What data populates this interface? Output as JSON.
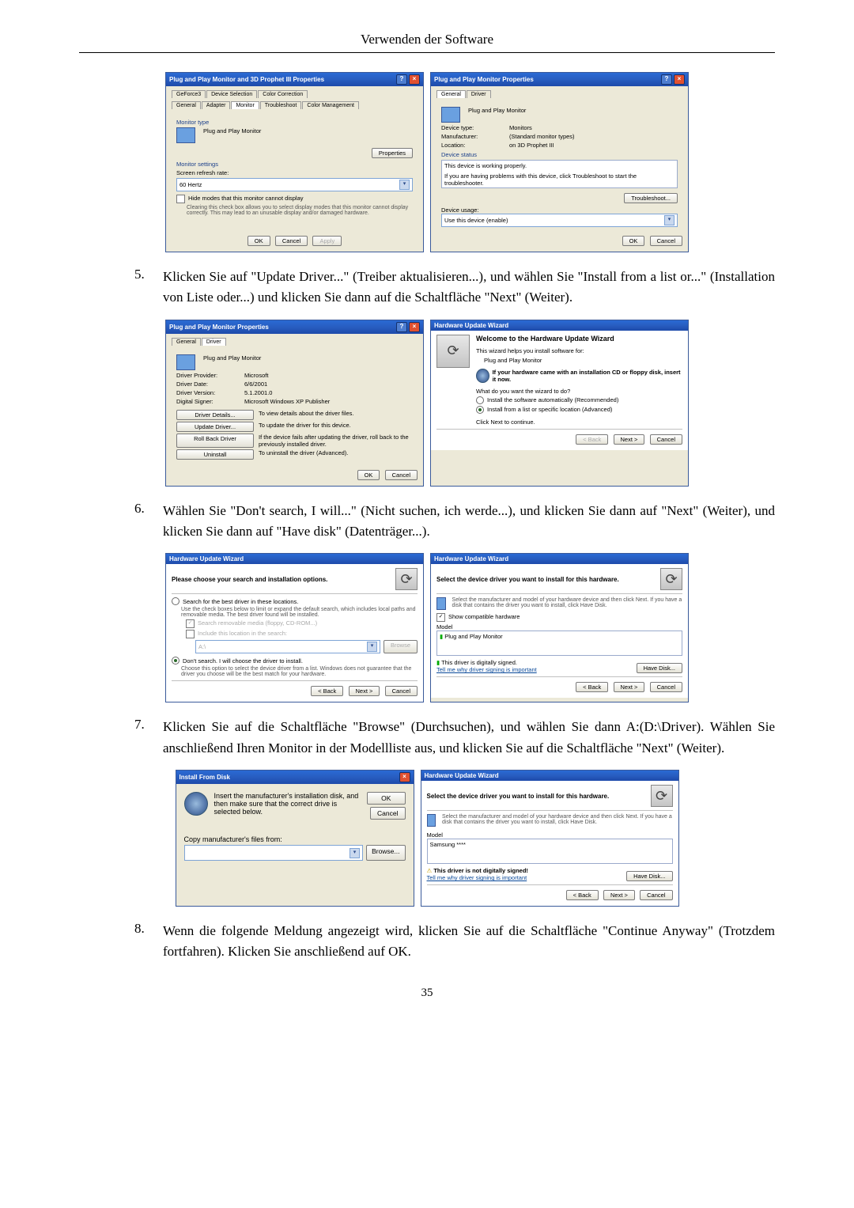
{
  "header": "Verwenden der Software",
  "page_number": "35",
  "steps": {
    "5": {
      "num": "5.",
      "text": "Klicken Sie auf \"Update Driver...\" (Treiber aktualisieren...), und wählen Sie \"Install from a list or...\" (Installation von Liste oder...) und klicken Sie dann auf die Schaltfläche \"Next\" (Weiter)."
    },
    "6": {
      "num": "6.",
      "text": "Wählen Sie \"Don't search, I will...\" (Nicht suchen, ich werde...), und klicken Sie dann auf \"Next\" (Weiter), und klicken Sie dann auf \"Have disk\" (Datenträger...)."
    },
    "7": {
      "num": "7.",
      "text": "Klicken Sie auf die Schaltfläche \"Browse\" (Durchsuchen), und wählen Sie dann A:(D:\\Driver). Wählen Sie anschließend Ihren Monitor in der Modellliste aus, und klicken Sie auf die Schaltfläche \"Next\" (Weiter)."
    },
    "8": {
      "num": "8.",
      "text": "Wenn die folgende Meldung angezeigt wird, klicken Sie auf die Schaltfläche \"Continue Anyway\" (Trotzdem fortfahren). Klicken Sie anschließend auf OK."
    }
  },
  "fig_a1": {
    "title": "Plug and Play Monitor and 3D Prophet III Properties",
    "tabs_row1": [
      "GeForce3",
      "Device Selection",
      "Color Correction"
    ],
    "tabs_row2": [
      "General",
      "Adapter",
      "Monitor",
      "Troubleshoot",
      "Color Management"
    ],
    "monitor_type": "Monitor type",
    "monitor_name": "Plug and Play Monitor",
    "properties_btn": "Properties",
    "monitor_settings": "Monitor settings",
    "refresh_label": "Screen refresh rate:",
    "refresh_value": "60 Hertz",
    "hide_modes": "Hide modes that this monitor cannot display",
    "hide_desc": "Clearing this check box allows you to select display modes that this monitor cannot display correctly. This may lead to an unusable display and/or damaged hardware.",
    "ok": "OK",
    "cancel": "Cancel",
    "apply": "Apply"
  },
  "fig_a2": {
    "title": "Plug and Play Monitor Properties",
    "tabs": [
      "General",
      "Driver"
    ],
    "name": "Plug and Play Monitor",
    "rows": {
      "type_l": "Device type:",
      "type_v": "Monitors",
      "manu_l": "Manufacturer:",
      "manu_v": "(Standard monitor types)",
      "loc_l": "Location:",
      "loc_v": "on 3D Prophet III"
    },
    "status_lbl": "Device status",
    "status_txt": "This device is working properly.",
    "status_help": "If you are having problems with this device, click Troubleshoot to start the troubleshooter.",
    "troubleshoot": "Troubleshoot...",
    "usage_lbl": "Device usage:",
    "usage_val": "Use this device (enable)",
    "ok": "OK",
    "cancel": "Cancel"
  },
  "fig_b1": {
    "title": "Plug and Play Monitor Properties",
    "tabs": [
      "General",
      "Driver"
    ],
    "name": "Plug and Play Monitor",
    "rows": {
      "prov_l": "Driver Provider:",
      "prov_v": "Microsoft",
      "date_l": "Driver Date:",
      "date_v": "6/6/2001",
      "ver_l": "Driver Version:",
      "ver_v": "5.1.2001.0",
      "sig_l": "Digital Signer:",
      "sig_v": "Microsoft Windows XP Publisher"
    },
    "btns": {
      "details": "Driver Details...",
      "details_d": "To view details about the driver files.",
      "update": "Update Driver...",
      "update_d": "To update the driver for this device.",
      "roll": "Roll Back Driver",
      "roll_d": "If the device fails after updating the driver, roll back to the previously installed driver.",
      "unin": "Uninstall",
      "unin_d": "To uninstall the driver (Advanced)."
    },
    "ok": "OK",
    "cancel": "Cancel"
  },
  "fig_b2": {
    "title": "Hardware Update Wizard",
    "welcome": "Welcome to the Hardware Update Wizard",
    "helps": "This wizard helps you install software for:",
    "device": "Plug and Play Monitor",
    "cd_note": "If your hardware came with an installation CD or floppy disk, insert it now.",
    "what": "What do you want the wizard to do?",
    "opt1": "Install the software automatically (Recommended)",
    "opt2": "Install from a list or specific location (Advanced)",
    "cont": "Click Next to continue.",
    "back": "< Back",
    "next": "Next >",
    "cancel": "Cancel"
  },
  "fig_c1": {
    "title": "Hardware Update Wizard",
    "heading": "Please choose your search and installation options.",
    "opt_search": "Search for the best driver in these locations.",
    "opt_search_desc": "Use the check boxes below to limit or expand the default search, which includes local paths and removable media. The best driver found will be installed.",
    "chk1": "Search removable media (floppy, CD-ROM...)",
    "chk2": "Include this location in the search:",
    "path": "A:\\",
    "browse": "Browse",
    "opt_dont": "Don't search. I will choose the driver to install.",
    "opt_dont_desc": "Choose this option to select the device driver from a list. Windows does not guarantee that the driver you choose will be the best match for your hardware.",
    "back": "< Back",
    "next": "Next >",
    "cancel": "Cancel"
  },
  "fig_c2": {
    "title": "Hardware Update Wizard",
    "heading": "Select the device driver you want to install for this hardware.",
    "desc": "Select the manufacturer and model of your hardware device and then click Next. If you have a disk that contains the driver you want to install, click Have Disk.",
    "show_compat": "Show compatible hardware",
    "model_lbl": "Model",
    "model_val": "Plug and Play Monitor",
    "signed": "This driver is digitally signed.",
    "tell": "Tell me why driver signing is important",
    "have_disk": "Have Disk...",
    "back": "< Back",
    "next": "Next >",
    "cancel": "Cancel"
  },
  "fig_d1": {
    "title": "Install From Disk",
    "text": "Insert the manufacturer's installation disk, and then make sure that the correct drive is selected below.",
    "ok": "OK",
    "cancel": "Cancel",
    "copy_from": "Copy manufacturer's files from:",
    "path": "",
    "browse": "Browse..."
  },
  "fig_d2": {
    "title": "Hardware Update Wizard",
    "heading": "Select the device driver you want to install for this hardware.",
    "desc": "Select the manufacturer and model of your hardware device and then click Next. If you have a disk that contains the driver you want to install, click Have Disk.",
    "model_lbl": "Model",
    "model_val": "Samsung ****",
    "not_signed": "This driver is not digitally signed!",
    "tell": "Tell me why driver signing is important",
    "have_disk": "Have Disk...",
    "back": "< Back",
    "next": "Next >",
    "cancel": "Cancel"
  }
}
